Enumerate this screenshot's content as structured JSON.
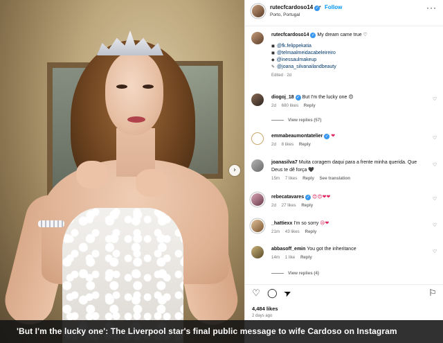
{
  "post": {
    "username": "rutecfcardoso14",
    "follow_label": "Follow",
    "dot": "•",
    "location": "Porto, Portugal",
    "more_label": "···",
    "carousel_next": "›"
  },
  "caption": {
    "username": "rutecfcardoso14",
    "text": "My dream came true ♡",
    "credits": [
      {
        "prefix": "◼",
        "handle": "@fk.felippekatia"
      },
      {
        "prefix": "◼",
        "handle": "@telmaalmeidacabeleireiro"
      },
      {
        "prefix": "◆",
        "handle": "@inessaulmakeup"
      },
      {
        "prefix": "✎",
        "handle": "@joana_silvanailandbeauty"
      }
    ],
    "edited": "Edited · 2d"
  },
  "comments": [
    {
      "username": "diogoj_18",
      "verified": true,
      "text": "But I'm the lucky one",
      "emoji": "😍",
      "time": "2d",
      "likes": "680 likes",
      "reply": "Reply",
      "view_replies": "View replies (57)"
    },
    {
      "username": "emmabeaumontatelier",
      "verified": true,
      "text": "",
      "emoji": "❤",
      "time": "2d",
      "likes": "8 likes",
      "reply": "Reply"
    },
    {
      "username": "joanasilva7",
      "verified": false,
      "text": "Muita coragem daqui para a frente minha querida. Que Deus te dê força",
      "emoji": "🖤",
      "time": "15m",
      "likes": "7 likes",
      "reply": "Reply",
      "translation": "See translation"
    },
    {
      "username": "rebecatavares",
      "verified": true,
      "text": "",
      "emoji": "😍😍❤❤",
      "time": "2d",
      "likes": "27 likes",
      "reply": "Reply"
    },
    {
      "username": "_hattiexx",
      "verified": false,
      "text": "I'm so sorry",
      "emoji": "😢❤",
      "time": "21m",
      "likes": "43 likes",
      "reply": "Reply"
    },
    {
      "username": "abbasoff_emin",
      "verified": false,
      "text": "You got the inheritance",
      "emoji": "",
      "time": "14m",
      "likes": "1 like",
      "reply": "Reply",
      "view_replies": "View replies (4)"
    }
  ],
  "actions": {
    "like_icon": "♡",
    "comment_icon": "◯",
    "share_icon": "➤",
    "save_icon": "⚐",
    "likes": "4,484 likes",
    "ago": "2 days ago"
  },
  "banner": {
    "headline": "'But I'm the lucky one': The Liverpool star's final public message to wife Cardoso on Instagram"
  },
  "colors": {
    "link_blue": "#0095f6",
    "verified_blue": "#3897f0",
    "heart_red": "#e0245e",
    "banner_bg": "#141414"
  }
}
